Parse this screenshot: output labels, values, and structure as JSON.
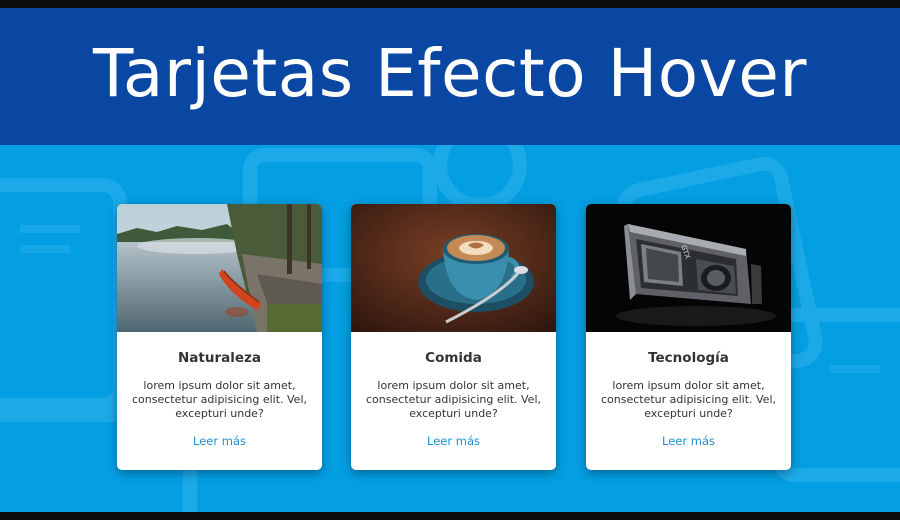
{
  "header": {
    "title": "Tarjetas Efecto Hover"
  },
  "cards": [
    {
      "title": "Naturaleza",
      "text": "lorem ipsum dolor sit amet, consectetur adipisicing elit. Vel, excepturi unde?",
      "link": "Leer más",
      "image": "lake-canoe-photo"
    },
    {
      "title": "Comida",
      "text": "lorem ipsum dolor sit amet, consectetur adipisicing elit. Vel, excepturi unde?",
      "link": "Leer más",
      "image": "coffee-cup-photo"
    },
    {
      "title": "Tecnología",
      "text": "lorem ipsum dolor sit amet, consectetur adipisicing elit. Vel, excepturi unde?",
      "link": "Leer más",
      "image": "gpu-card-photo"
    }
  ],
  "colors": {
    "banner": "#0a47a3",
    "background": "#049ee2",
    "link": "#1f8fd0",
    "text": "#333333"
  }
}
